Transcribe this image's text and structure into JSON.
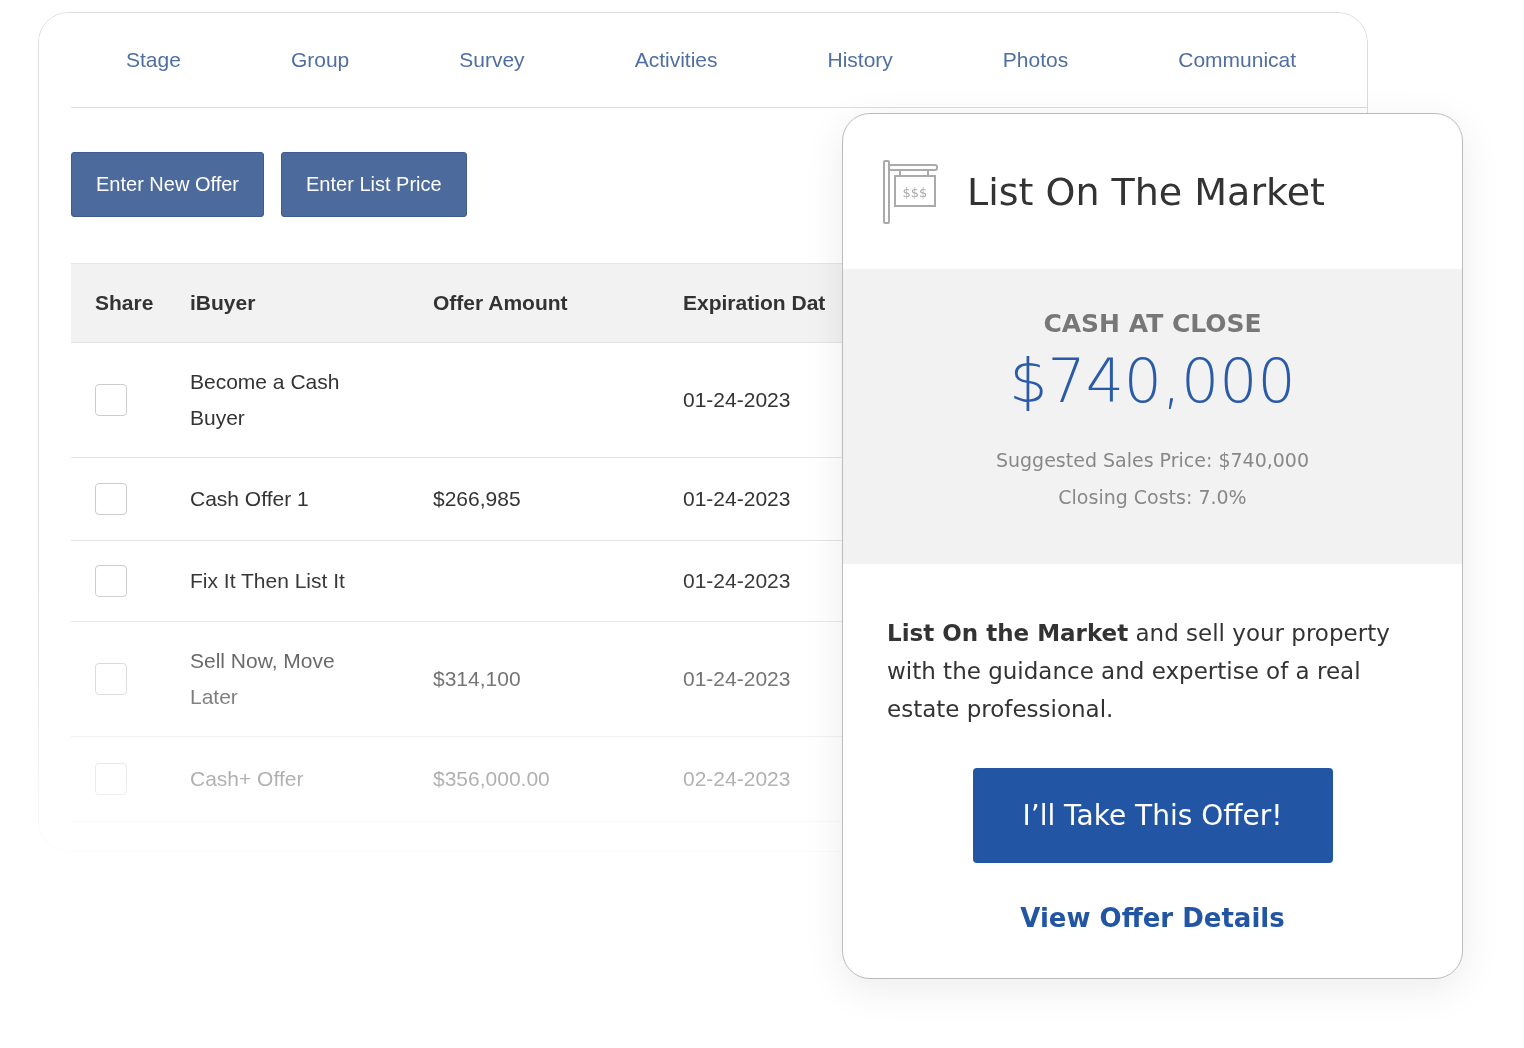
{
  "tabs": [
    {
      "label": "Stage"
    },
    {
      "label": "Group"
    },
    {
      "label": "Survey"
    },
    {
      "label": "Activities"
    },
    {
      "label": "History"
    },
    {
      "label": "Photos"
    },
    {
      "label": "Communicat"
    }
  ],
  "actions": [
    "Enter New Offer",
    "Enter List Price"
  ],
  "table": {
    "columns": [
      "Share",
      "iBuyer",
      "Offer Amount",
      "Expiration Dat"
    ],
    "rows": [
      {
        "checked": false,
        "ibuyer": "Become a Cash Buyer",
        "date": "01-24-2023"
      },
      {
        "checked": false,
        "ibuyer": "Cash Offer 1",
        "amount": "$266,985",
        "date": "01-24-2023"
      },
      {
        "checked": false,
        "ibuyer": "Fix It Then List It",
        "date": "01-24-2023"
      },
      {
        "checked": false,
        "ibuyer": "Sell Now, Move Later",
        "amount": "$314,100",
        "date": "01-24-2023"
      },
      {
        "checked": false,
        "ibuyer": "Cash+ Offer",
        "amount": "$356,000.00",
        "date": "02-24-2023"
      }
    ]
  },
  "offer_card": {
    "sign_text": "$$$",
    "title": "List On The Market",
    "label": "CASH AT CLOSE",
    "amount": "$740,000",
    "details": [
      "Suggested Sales Price: $740,000",
      "Closing Costs: 7.0%"
    ],
    "description": "**List On the Market** and sell your property with the guidance and expertise of a real estate professional.",
    "button": "I’ll Take This Offer!",
    "link": "View Offer Details"
  }
}
